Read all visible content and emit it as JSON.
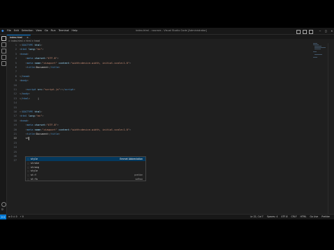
{
  "menu": [
    "File",
    "Edit",
    "Selection",
    "View",
    "Go",
    "Run",
    "Terminal",
    "Help"
  ],
  "window_title": "index.html - courses - Visual Studio Code [Administrator]",
  "tab": {
    "label": "index.html",
    "close": "×"
  },
  "breadcrumb": "> index.html > html > head",
  "lines": [
    {
      "n": "1",
      "c": [
        [
          "punc",
          "<!"
        ],
        [
          "tag",
          "DOCTYPE"
        ],
        [
          "attr",
          " html"
        ],
        [
          "punc",
          ">"
        ]
      ]
    },
    {
      "n": "2",
      "c": [
        [
          "punc",
          "<"
        ],
        [
          "tag",
          "html"
        ],
        [
          "attr",
          " lang"
        ],
        [
          "punc",
          "="
        ],
        [
          "str",
          "\"en\""
        ],
        [
          "punc",
          ">"
        ]
      ]
    },
    {
      "n": "3",
      "c": [
        [
          "punc",
          "<"
        ],
        [
          "tag",
          "head"
        ],
        [
          "punc",
          ">"
        ]
      ]
    },
    {
      "n": "4",
      "c": [
        [
          "txt",
          "    "
        ],
        [
          "punc",
          "<"
        ],
        [
          "tag",
          "meta"
        ],
        [
          "attr",
          " charset"
        ],
        [
          "punc",
          "="
        ],
        [
          "str",
          "\"UTF-8\""
        ],
        [
          "punc",
          ">"
        ]
      ]
    },
    {
      "n": "5",
      "c": [
        [
          "txt",
          "    "
        ],
        [
          "punc",
          "<"
        ],
        [
          "tag",
          "meta"
        ],
        [
          "attr",
          " name"
        ],
        [
          "punc",
          "="
        ],
        [
          "str",
          "\"viewport\""
        ],
        [
          "attr",
          " content"
        ],
        [
          "punc",
          "="
        ],
        [
          "str",
          "\"width=device-width, initial-scale=1.0\""
        ],
        [
          "punc",
          ">"
        ]
      ]
    },
    {
      "n": "6",
      "c": [
        [
          "txt",
          "    "
        ],
        [
          "punc",
          "<"
        ],
        [
          "tag",
          "title"
        ],
        [
          "punc",
          ">"
        ],
        [
          "txt",
          "Document"
        ],
        [
          "punc",
          "</"
        ],
        [
          "tag",
          "title"
        ],
        [
          "punc",
          ">"
        ]
      ]
    },
    {
      "n": "7",
      "c": []
    },
    {
      "n": "8",
      "c": [
        [
          "punc",
          "</"
        ],
        [
          "tag",
          "head"
        ],
        [
          "punc",
          ">"
        ]
      ]
    },
    {
      "n": "9",
      "c": [
        [
          "punc",
          "<"
        ],
        [
          "tag",
          "body"
        ],
        [
          "punc",
          ">"
        ]
      ]
    },
    {
      "n": "10",
      "c": []
    },
    {
      "n": "11",
      "c": [
        [
          "txt",
          "    "
        ],
        [
          "punc",
          "<"
        ],
        [
          "tag",
          "script"
        ],
        [
          "attr",
          " src"
        ],
        [
          "punc",
          "="
        ],
        [
          "str",
          "\"script.js\""
        ],
        [
          "punc",
          "></"
        ],
        [
          "tag",
          "script"
        ],
        [
          "punc",
          ">"
        ]
      ]
    },
    {
      "n": "12",
      "c": [
        [
          "punc",
          "</"
        ],
        [
          "tag",
          "body"
        ],
        [
          "punc",
          ">"
        ]
      ]
    },
    {
      "n": "13",
      "c": [
        [
          "punc",
          "</"
        ],
        [
          "tag",
          "html"
        ],
        [
          "punc",
          ">"
        ],
        [
          "txt",
          "     |"
        ]
      ]
    },
    {
      "n": "14",
      "c": []
    },
    {
      "n": "15",
      "c": []
    },
    {
      "n": "16",
      "c": [
        [
          "punc",
          "<!"
        ],
        [
          "tag",
          "DOCTYPE"
        ],
        [
          "attr",
          " html"
        ],
        [
          "punc",
          ">"
        ]
      ]
    },
    {
      "n": "17",
      "c": [
        [
          "punc",
          "<"
        ],
        [
          "tag",
          "html"
        ],
        [
          "attr",
          " lang"
        ],
        [
          "punc",
          "="
        ],
        [
          "str",
          "\"en\""
        ],
        [
          "punc",
          ">"
        ]
      ]
    },
    {
      "n": "18",
      "c": [
        [
          "punc",
          "<"
        ],
        [
          "tag",
          "head"
        ],
        [
          "punc",
          ">"
        ]
      ]
    },
    {
      "n": "19",
      "c": [
        [
          "txt",
          "    "
        ],
        [
          "punc",
          "<"
        ],
        [
          "tag",
          "meta"
        ],
        [
          "attr",
          " charset"
        ],
        [
          "punc",
          "="
        ],
        [
          "str",
          "\"UTF-8\""
        ],
        [
          "punc",
          ">"
        ]
      ]
    },
    {
      "n": "20",
      "c": [
        [
          "txt",
          "    "
        ],
        [
          "punc",
          "<"
        ],
        [
          "tag",
          "meta"
        ],
        [
          "attr",
          " name"
        ],
        [
          "punc",
          "="
        ],
        [
          "str",
          "\"viewport\""
        ],
        [
          "attr",
          " content"
        ],
        [
          "punc",
          "="
        ],
        [
          "str",
          "\"width=device-width, initial-scale=1.0\""
        ],
        [
          "punc",
          ">"
        ]
      ]
    },
    {
      "n": "21",
      "c": [
        [
          "txt",
          "    "
        ],
        [
          "punc",
          "<"
        ],
        [
          "tag",
          "title"
        ],
        [
          "punc",
          ">"
        ],
        [
          "txt",
          "Document"
        ],
        [
          "punc",
          "</"
        ],
        [
          "tag",
          "title"
        ],
        [
          "punc",
          ">"
        ],
        [
          "txt",
          "  "
        ]
      ]
    },
    {
      "n": "22",
      "c": [
        [
          "txt",
          "    st"
        ]
      ]
    },
    {
      "n": "23",
      "c": []
    },
    {
      "n": "24",
      "c": []
    },
    {
      "n": "25",
      "c": []
    },
    {
      "n": "26",
      "c": []
    },
    {
      "n": "27",
      "c": []
    }
  ],
  "current_line": "22",
  "suggestions": [
    {
      "icon": "⬚",
      "label": "style",
      "detail": "Emmet Abbreviation",
      "selected": true
    },
    {
      "icon": "⬚",
      "label": "stroke",
      "detail": "",
      "selected": false
    },
    {
      "icon": "⬚",
      "label": "strong",
      "detail": "",
      "selected": false
    },
    {
      "icon": "⬚",
      "label": "style",
      "detail": "",
      "selected": false
    },
    {
      "icon": "⬚",
      "label": "st:f",
      "detail": "prettier",
      "selected": false
    },
    {
      "icon": "⬚",
      "label": "st:fu",
      "detail": "softwa",
      "selected": false
    }
  ],
  "status": {
    "remote": "><",
    "left": [
      "⊗ 0  ⚠ 0",
      "⚡ 0"
    ],
    "right": [
      "Ln 22, Col 7",
      "Spaces: 4",
      "UTF-8",
      "CRLF",
      "HTML",
      "Go Live",
      "Prettier"
    ]
  },
  "colors": {
    "accent": "#0078d4",
    "editor_bg": "#1f1f1f",
    "suggest_sel": "#04395e"
  }
}
